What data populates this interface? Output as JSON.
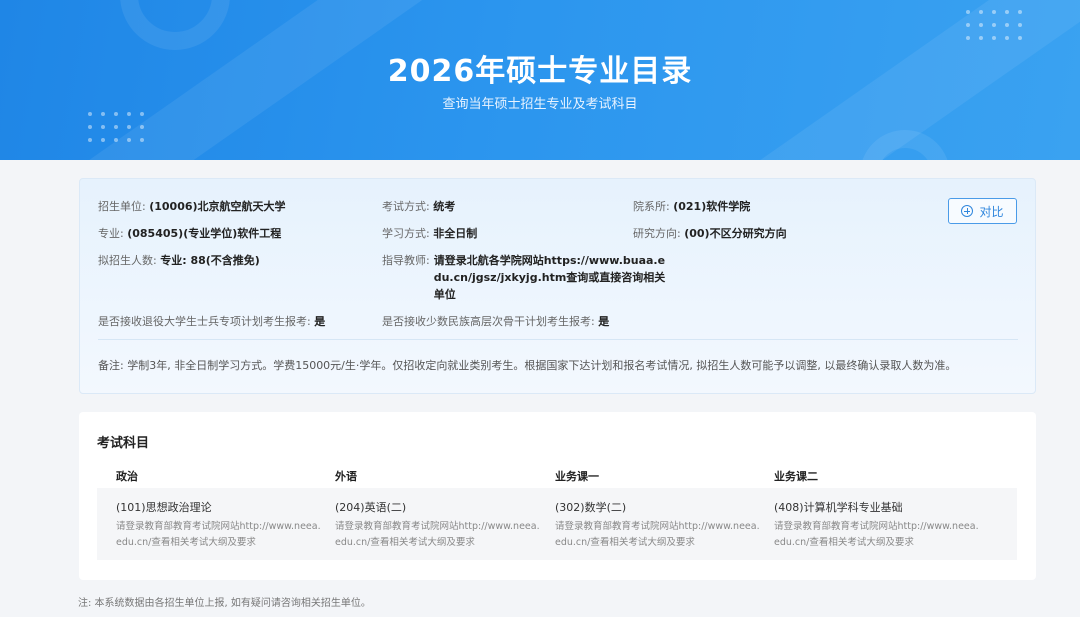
{
  "banner": {
    "title": "2026年硕士专业目录",
    "subtitle": "查询当年硕士招生专业及考试科目"
  },
  "info": {
    "unit": {
      "label": "招生单位:",
      "value": "(10006)北京航空航天大学"
    },
    "exam_method": {
      "label": "考试方式:",
      "value": "统考"
    },
    "department": {
      "label": "院系所:",
      "value": "(021)软件学院"
    },
    "major": {
      "label": "专业:",
      "value": "(085405)(专业学位)软件工程"
    },
    "study_mode": {
      "label": "学习方式:",
      "value": "非全日制"
    },
    "research_direction": {
      "label": "研究方向:",
      "value": "(00)不区分研究方向"
    },
    "planned_enrollment": {
      "label": "拟招生人数:",
      "value": "专业: 88(不含推免)"
    },
    "advisor": {
      "label": "指导教师:",
      "value_lines": [
        "请登录北航各学院网站https://www.buaa.e",
        "du.cn/jgsz/jxkyjg.htm查询或直接咨询相关",
        "单位"
      ]
    },
    "veteran_plan": {
      "label": "是否接收退役大学生士兵专项计划考生报考:",
      "value": "是"
    },
    "minority_plan": {
      "label": "是否接收少数民族高层次骨干计划考生报考:",
      "value": "是"
    },
    "remark": "备注: 学制3年, 非全日制学习方式。学费15000元/生·学年。仅招收定向就业类别考生。根据国家下达计划和报名考试情况, 拟招生人数可能予以调整, 以最终确认录取人数为准。",
    "compare_button": "对比"
  },
  "exam": {
    "title": "考试科目",
    "columns": [
      "政治",
      "外语",
      "业务课一",
      "业务课二"
    ],
    "subjects": [
      {
        "name": "(101)思想政治理论",
        "desc_lines": [
          "请登录教育部教育考试院网站http://www.neea.",
          "edu.cn/查看相关考试大纲及要求"
        ]
      },
      {
        "name": "(204)英语(二)",
        "desc_lines": [
          "请登录教育部教育考试院网站http://www.neea.",
          "edu.cn/查看相关考试大纲及要求"
        ]
      },
      {
        "name": "(302)数学(二)",
        "desc_lines": [
          "请登录教育部教育考试院网站http://www.neea.",
          "edu.cn/查看相关考试大纲及要求"
        ]
      },
      {
        "name": "(408)计算机学科专业基础",
        "desc_lines": [
          "请登录教育部教育考试院网站http://www.neea.",
          "edu.cn/查看相关考试大纲及要求"
        ]
      }
    ]
  },
  "footnote": "注: 本系统数据由各招生单位上报, 如有疑问请咨询相关招生单位。"
}
